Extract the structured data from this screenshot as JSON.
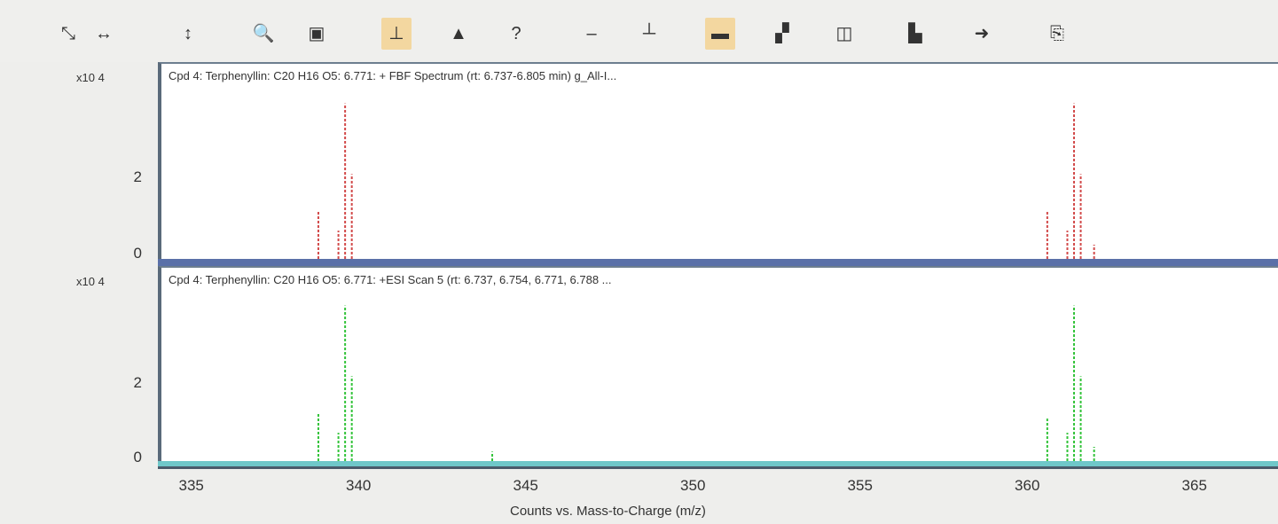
{
  "toolbar": {
    "buttons": [
      {
        "name": "zoom-fit-icon",
        "glyph": "⤡",
        "active": false
      },
      {
        "name": "autoscale-x-icon",
        "glyph": "↔",
        "active": false
      },
      {
        "name": "autoscale-y-icon",
        "glyph": "↕",
        "active": false
      },
      {
        "name": "magnifier-icon",
        "glyph": "🔍",
        "active": false
      },
      {
        "name": "properties-icon",
        "glyph": "▣",
        "active": false
      },
      {
        "name": "peak-label-icon",
        "glyph": "⊥",
        "active": true
      },
      {
        "name": "green-spectrum-icon",
        "glyph": "▲",
        "active": false
      },
      {
        "name": "help-icon",
        "glyph": "?",
        "active": false
      },
      {
        "name": "minus-icon",
        "glyph": "–",
        "active": false
      },
      {
        "name": "single-peak-icon",
        "glyph": "┴",
        "active": false
      },
      {
        "name": "overlay-range-icon",
        "glyph": "▬",
        "active": true
      },
      {
        "name": "multi-plot-icon",
        "glyph": "▞",
        "active": false
      },
      {
        "name": "window-icon",
        "glyph": "◫",
        "active": false
      },
      {
        "name": "bar-chart-icon",
        "glyph": "▙",
        "active": false
      },
      {
        "name": "arrow-right-icon",
        "glyph": "➜",
        "active": false
      },
      {
        "name": "export-icon",
        "glyph": "⎘",
        "active": false
      }
    ]
  },
  "panels": [
    {
      "title": "Cpd 4: Terphenyllin: C20 H16 O5: 6.771: + FBF Spectrum (rt: 6.737-6.805 min) g_All-I...",
      "y_multiplier": "x10 4",
      "y_ticks": [
        "2",
        "0"
      ],
      "color": "#d24a4a",
      "baseline_color": "#5a70a8"
    },
    {
      "title": "Cpd 4: Terphenyllin: C20 H16 O5: 6.771: +ESI Scan 5 (rt: 6.737, 6.754, 6.771, 6.788 ...",
      "y_multiplier": "x10 4",
      "y_ticks": [
        "2",
        "0"
      ],
      "color": "#33c33a",
      "baseline_color": "#6fc7c9"
    }
  ],
  "x_axis": {
    "title": "Counts vs. Mass-to-Charge (m/z)",
    "ticks": [
      "335",
      "340",
      "345",
      "350",
      "355",
      "360",
      "365"
    ]
  },
  "chart_data": [
    {
      "type": "bar",
      "title": "Cpd 4: Terphenyllin: C20 H16 O5: 6.771: + FBF Spectrum (rt: 6.737-6.805 min) g_All-I...",
      "xlabel": "Counts vs. Mass-to-Charge (m/z)",
      "ylabel": "",
      "xlim": [
        334.0,
        367.5
      ],
      "ylim": [
        0,
        3.5
      ],
      "x": [
        338.8,
        339.4,
        339.6,
        339.8,
        360.6,
        361.2,
        361.4,
        361.6,
        362.0
      ],
      "values": [
        1.0,
        0.6,
        3.3,
        1.8,
        1.0,
        0.6,
        3.3,
        1.8,
        0.3
      ]
    },
    {
      "type": "bar",
      "title": "Cpd 4: Terphenyllin: C20 H16 O5: 6.771: +ESI Scan 5 (rt: 6.737, 6.754, 6.771, 6.788 ...",
      "xlabel": "Counts vs. Mass-to-Charge (m/z)",
      "ylabel": "",
      "xlim": [
        334.0,
        367.5
      ],
      "ylim": [
        0,
        3.5
      ],
      "x": [
        338.8,
        339.4,
        339.6,
        339.8,
        344.0,
        360.6,
        361.2,
        361.4,
        361.6,
        362.0
      ],
      "values": [
        1.0,
        0.6,
        3.3,
        1.8,
        0.2,
        0.9,
        0.6,
        3.3,
        1.8,
        0.3
      ]
    }
  ]
}
